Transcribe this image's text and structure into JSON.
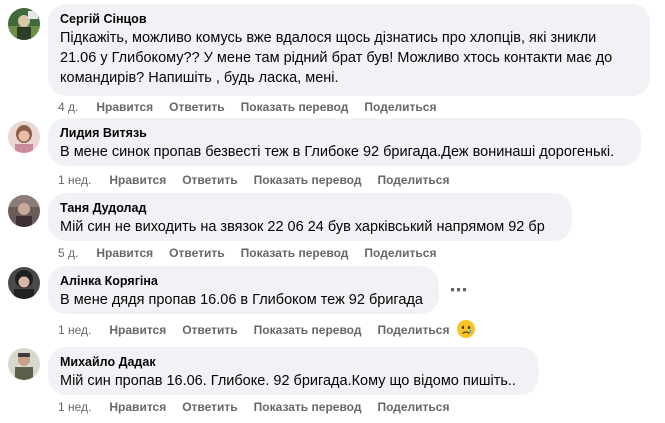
{
  "action_labels": {
    "like": "Нравится",
    "reply": "Ответить",
    "translate": "Показать перевод",
    "share": "Поделиться"
  },
  "comments": [
    {
      "author": "Сергій Сінцов",
      "text": "Підкажіть, можливо комусь вже вдалося щось дізнатись про хлопців, які зникли\n21.06 у Глибокому?? У мене там рідний брат був! Можливо хтось контакти має до\nкомандирів? Напишіть , будь ласка, мені.",
      "time": "4 д."
    },
    {
      "author": "Лидия Витязь",
      "text": "В мене синок пропав безвесті теж в Глибоке 92 бригада.Деж вонинаші дорогенькі.",
      "time": "1 нед."
    },
    {
      "author": "Таня Дудолад",
      "text": "Мій син не виходить на звязок 22 06 24 був харківський напрямом 92 бр",
      "time": "5 д."
    },
    {
      "author": "Алінка Корягіна",
      "text": "В мене дядя пропав 16.06 в Глибоком теж 92 бригада",
      "time": "1 нед.",
      "more_icon": "⋯",
      "reaction": "sad-face-emoji"
    },
    {
      "author": "Михайло Дадак",
      "text": "Мій син пропав 16.06. Глибоке. 92 бригада.Кому що відомо пишіть..",
      "time": "1 нед."
    }
  ]
}
